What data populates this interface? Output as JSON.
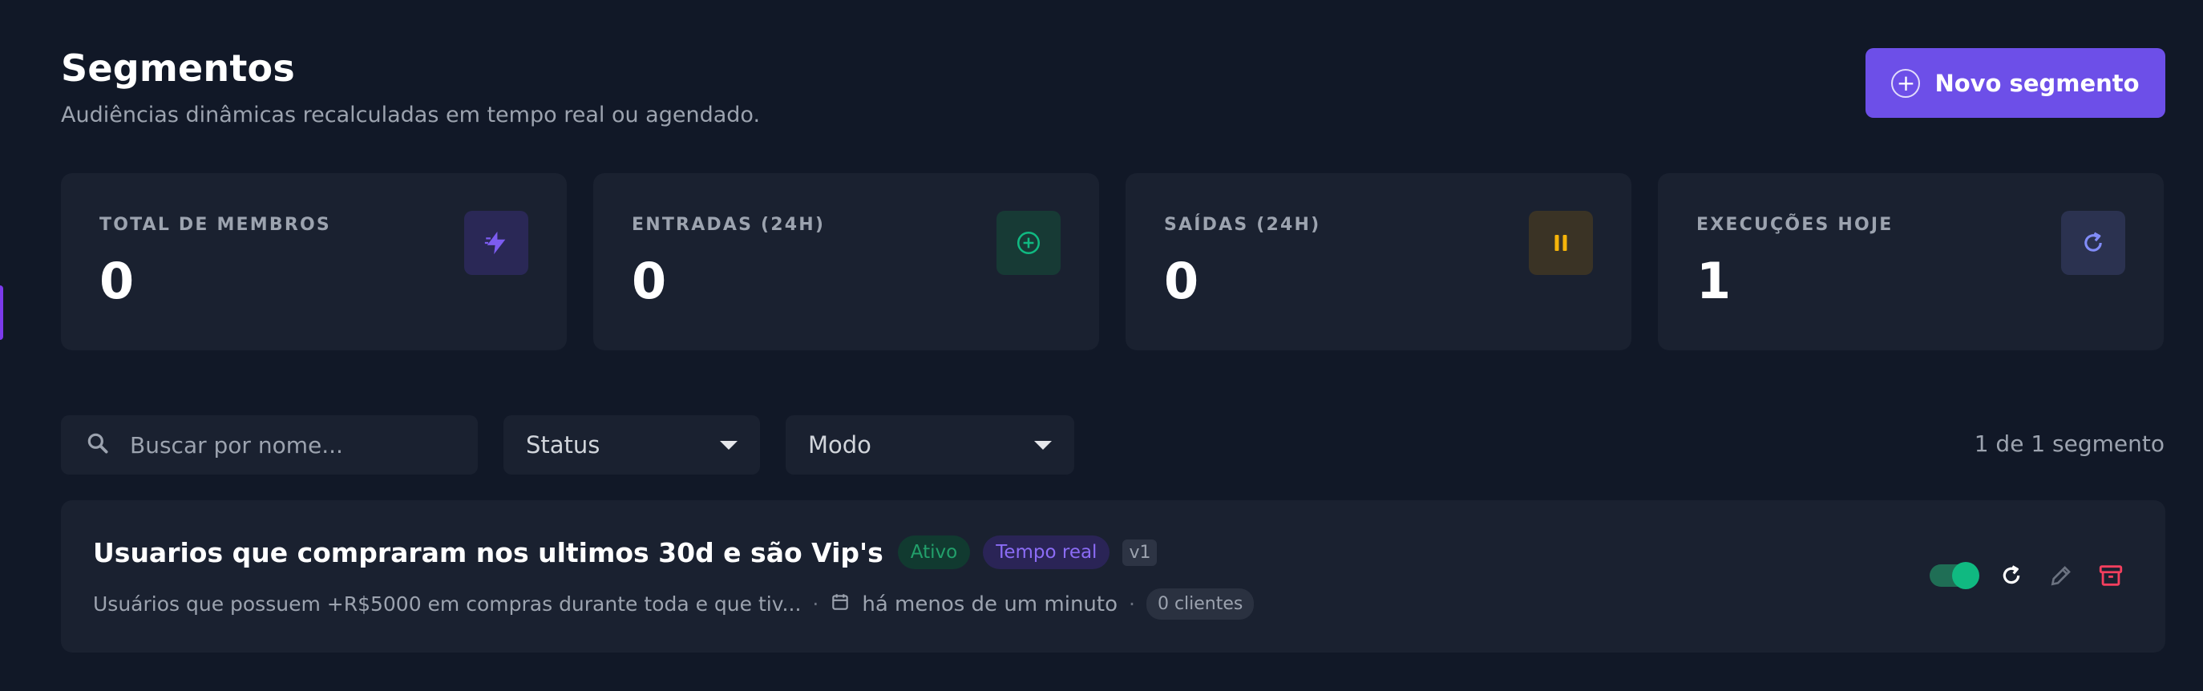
{
  "header": {
    "title": "Segmentos",
    "subtitle": "Audiências dinâmicas recalculadas em tempo real ou agendado.",
    "new_button_label": "Novo segmento"
  },
  "stats": [
    {
      "label": "TOTAL DE MEMBROS",
      "value": "0",
      "icon": "bolt-icon",
      "color": "#7c5cf0"
    },
    {
      "label": "ENTRADAS (24H)",
      "value": "0",
      "icon": "plus-circle-icon",
      "color": "#10b981"
    },
    {
      "label": "SAÍDAS (24H)",
      "value": "0",
      "icon": "pause-icon",
      "color": "#f5b40a"
    },
    {
      "label": "EXECUÇÕES HOJE",
      "value": "1",
      "icon": "refresh-icon",
      "color": "#818cf8"
    }
  ],
  "filters": {
    "search_placeholder": "Buscar por nome...",
    "status_label": "Status",
    "mode_label": "Modo",
    "count_text": "1 de 1 segmento"
  },
  "segments": [
    {
      "name": "Usuarios que compraram nos ultimos 30d e são Vip's",
      "status": "Ativo",
      "mode": "Tempo real",
      "version": "v1",
      "description": "Usuários que possuem +R$5000 em compras durante toda e que tiv...",
      "updated": "há menos de um minuto",
      "clients": "0 clientes",
      "enabled": true
    }
  ],
  "colors": {
    "background": "#111827",
    "card": "#1a2130",
    "accent": "#6d4fe8",
    "success": "#10b981",
    "danger": "#f43f5e"
  }
}
